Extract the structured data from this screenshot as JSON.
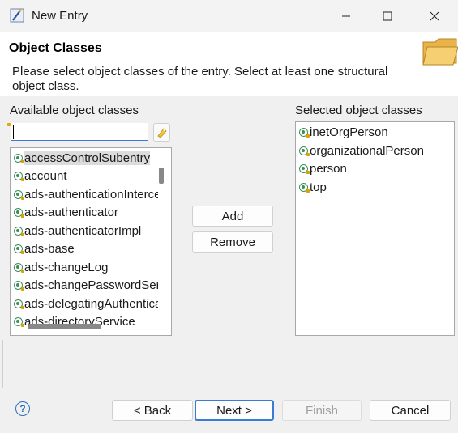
{
  "window": {
    "title": "New Entry",
    "icons": {
      "app": "ldap-entry-wand-icon",
      "minimize": "minimize-icon",
      "maximize": "maximize-icon",
      "close": "close-icon"
    }
  },
  "banner": {
    "title": "Object Classes",
    "description": "Please select object classes of the entry. Select at least one structural object class.",
    "icon": "folder-open-icon"
  },
  "available": {
    "label": "Available object classes",
    "filter_value": "",
    "items": [
      "accessControlSubentry",
      "account",
      "ads-authenticationInterceptor",
      "ads-authenticator",
      "ads-authenticatorImpl",
      "ads-base",
      "ads-changeLog",
      "ads-changePasswordServer",
      "ads-delegatingAuthenticator",
      "ads-directoryService"
    ],
    "selected_index": 0
  },
  "selected": {
    "label": "Selected object classes",
    "items": [
      "inetOrgPerson",
      "organizationalPerson",
      "person",
      "top"
    ]
  },
  "buttons": {
    "add": "Add",
    "remove": "Remove",
    "back": "< Back",
    "next": "Next >",
    "finish": "Finish",
    "cancel": "Cancel",
    "help": "?"
  },
  "colors": {
    "accent": "#3a7bd5",
    "object_class_icon": "#3d8f55",
    "disabled_text": "#a0a0a0"
  }
}
